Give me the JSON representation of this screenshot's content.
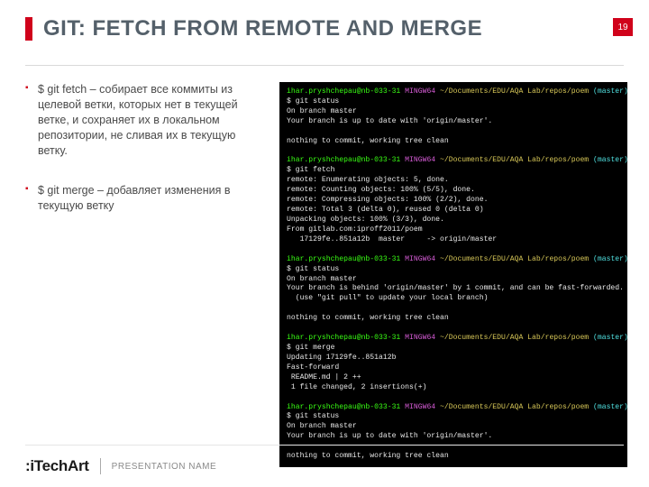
{
  "slide": {
    "title": "GIT: FETCH FROM REMOTE AND MERGE",
    "page_number": "19"
  },
  "bullets": [
    "$ git fetch –  собирает все коммиты из целевой ветки, которых нет в текущей ветке, и сохраняет их в локальном репозитории, не сливая их в текущую ветку.",
    "$ git merge – добавляет изменения в текущую ветку"
  ],
  "terminal": {
    "prompt_user": "ihar.pryshchepau@nb-033-31",
    "prompt_shell": "MINGW64",
    "prompt_path": "~/Documents/EDU/AQA Lab/repos/poem",
    "prompt_branch": "(master)",
    "blocks": [
      {
        "cmd": "git status",
        "out": "On branch master\nYour branch is up to date with 'origin/master'.\n\nnothing to commit, working tree clean"
      },
      {
        "cmd": "git fetch",
        "out": "remote: Enumerating objects: 5, done.\nremote: Counting objects: 100% (5/5), done.\nremote: Compressing objects: 100% (2/2), done.\nremote: Total 3 (delta 0), reused 0 (delta 0)\nUnpacking objects: 100% (3/3), done.\nFrom gitlab.com:iproff2011/poem\n   17129fe..851a12b  master     -> origin/master"
      },
      {
        "cmd": "git status",
        "out": "On branch master\nYour branch is behind 'origin/master' by 1 commit, and can be fast-forwarded.\n  (use \"git pull\" to update your local branch)\n\nnothing to commit, working tree clean"
      },
      {
        "cmd": "git merge",
        "out": "Updating 17129fe..851a12b\nFast-forward\n README.md | 2 ++\n 1 file changed, 2 insertions(+)"
      },
      {
        "cmd": "git status",
        "out": "On branch master\nYour branch is up to date with 'origin/master'.\n\nnothing to commit, working tree clean"
      }
    ]
  },
  "footer": {
    "logo_prefix": ":i",
    "logo_main": "TechArt",
    "presentation": "PRESENTATION NAME"
  }
}
